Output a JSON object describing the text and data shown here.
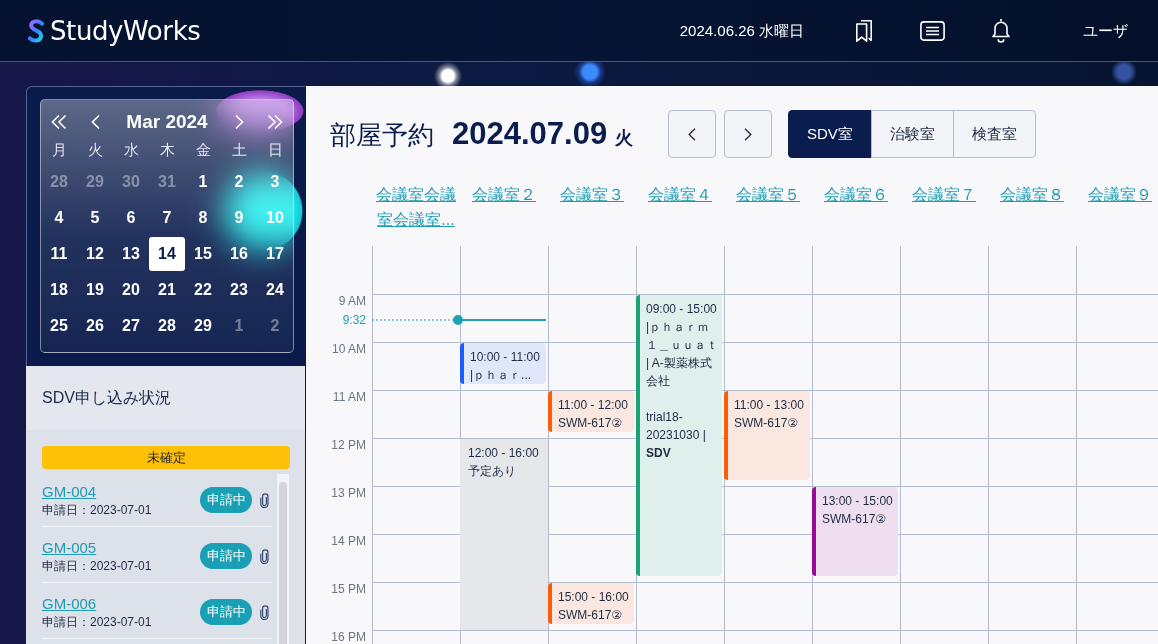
{
  "header": {
    "brand": "StudyWorks",
    "date": "2024.06.26 水曜日",
    "user": "ユーザ"
  },
  "calendar": {
    "month": "Mar 2024",
    "weekdays": [
      "月",
      "火",
      "水",
      "木",
      "金",
      "土",
      "日"
    ],
    "days": [
      {
        "label": "28",
        "outside": true,
        "selected": false
      },
      {
        "label": "29",
        "outside": true,
        "selected": false
      },
      {
        "label": "30",
        "outside": true,
        "selected": false
      },
      {
        "label": "31",
        "outside": true,
        "selected": false
      },
      {
        "label": "1",
        "outside": false,
        "selected": false
      },
      {
        "label": "2",
        "outside": false,
        "selected": false
      },
      {
        "label": "3",
        "outside": false,
        "selected": false
      },
      {
        "label": "4",
        "outside": false,
        "selected": false
      },
      {
        "label": "5",
        "outside": false,
        "selected": false
      },
      {
        "label": "6",
        "outside": false,
        "selected": false
      },
      {
        "label": "7",
        "outside": false,
        "selected": false
      },
      {
        "label": "8",
        "outside": false,
        "selected": false
      },
      {
        "label": "9",
        "outside": false,
        "selected": false
      },
      {
        "label": "10",
        "outside": false,
        "selected": false
      },
      {
        "label": "11",
        "outside": false,
        "selected": false
      },
      {
        "label": "12",
        "outside": false,
        "selected": false
      },
      {
        "label": "13",
        "outside": false,
        "selected": false
      },
      {
        "label": "14",
        "outside": false,
        "selected": true
      },
      {
        "label": "15",
        "outside": false,
        "selected": false
      },
      {
        "label": "16",
        "outside": false,
        "selected": false
      },
      {
        "label": "17",
        "outside": false,
        "selected": false
      },
      {
        "label": "18",
        "outside": false,
        "selected": false
      },
      {
        "label": "19",
        "outside": false,
        "selected": false
      },
      {
        "label": "20",
        "outside": false,
        "selected": false
      },
      {
        "label": "21",
        "outside": false,
        "selected": false
      },
      {
        "label": "22",
        "outside": false,
        "selected": false
      },
      {
        "label": "23",
        "outside": false,
        "selected": false
      },
      {
        "label": "24",
        "outside": false,
        "selected": false
      },
      {
        "label": "25",
        "outside": false,
        "selected": false
      },
      {
        "label": "26",
        "outside": false,
        "selected": false
      },
      {
        "label": "27",
        "outside": false,
        "selected": false
      },
      {
        "label": "28",
        "outside": false,
        "selected": false
      },
      {
        "label": "29",
        "outside": false,
        "selected": false
      },
      {
        "label": "1",
        "outside": true,
        "selected": false
      },
      {
        "label": "2",
        "outside": true,
        "selected": false
      }
    ]
  },
  "applications": {
    "title": "SDV申し込み状況",
    "group": "未確定",
    "items": [
      {
        "code": "GM-004",
        "date": "申請日：2023-07-01",
        "status": "申請中",
        "attachment": true
      },
      {
        "code": "GM-005",
        "date": "申請日：2023-07-01",
        "status": "申請中",
        "attachment": true
      },
      {
        "code": "GM-006",
        "date": "申請日：2023-07-01",
        "status": "申請中",
        "attachment": true
      }
    ]
  },
  "schedule": {
    "title": "部屋予約",
    "date": "2024.07.09",
    "weekday": "火",
    "room_types": [
      {
        "label": "SDV室",
        "selected": true
      },
      {
        "label": "治験室",
        "selected": false
      },
      {
        "label": "検査室",
        "selected": false
      }
    ],
    "hours": [
      "9 AM",
      "10 AM",
      "11 AM",
      "12 PM",
      "13 PM",
      "14 PM",
      "15 PM",
      "16 PM"
    ],
    "now": "9:32",
    "rooms": [
      {
        "label": "会議室会議室会議室...",
        "current_time": false
      },
      {
        "label": "会議室２",
        "current_time": true,
        "events": [
          {
            "kind": "booking",
            "color": "#1a5cff",
            "time": "10:00 - 11:00",
            "lines": [
              "|ｐｈａｒ..."
            ]
          },
          {
            "kind": "busy",
            "time": "12:00 - 16:00",
            "lines": [
              "予定あり"
            ]
          }
        ]
      },
      {
        "label": "会議室３",
        "current_time": false,
        "events": [
          {
            "kind": "booking",
            "color": "#ff5a0a",
            "time": "11:00 - 12:00",
            "lines": [
              "SWM-617②"
            ]
          },
          {
            "kind": "booking",
            "color": "#ff5a0a",
            "time": "15:00 - 16:00",
            "lines": [
              "SWM-617②"
            ]
          }
        ]
      },
      {
        "label": "会議室４",
        "current_time": false,
        "events": [
          {
            "kind": "booking",
            "color": "#17a673",
            "time": "09:00 - 15:00",
            "lines": [
              "|ｐｈａｒｍ１＿ｕｕａｔ | A-製薬株式会社",
              "trial18-20231030 | **SDV**"
            ]
          }
        ]
      },
      {
        "label": "会議室５",
        "current_time": false,
        "events": [
          {
            "kind": "booking",
            "color": "#ff5a0a",
            "time": "11:00 - 13:00",
            "lines": [
              "SWM-617②"
            ]
          }
        ]
      },
      {
        "label": "会議室６",
        "current_time": false,
        "events": [
          {
            "kind": "booking",
            "color": "#9b0a99",
            "time": "13:00 - 15:00",
            "lines": [
              "SWM-617②"
            ]
          }
        ]
      },
      {
        "label": "会議室７",
        "current_time": false
      },
      {
        "label": "会議室８",
        "current_time": false
      },
      {
        "label": "会議室９",
        "current_time": false
      }
    ]
  }
}
